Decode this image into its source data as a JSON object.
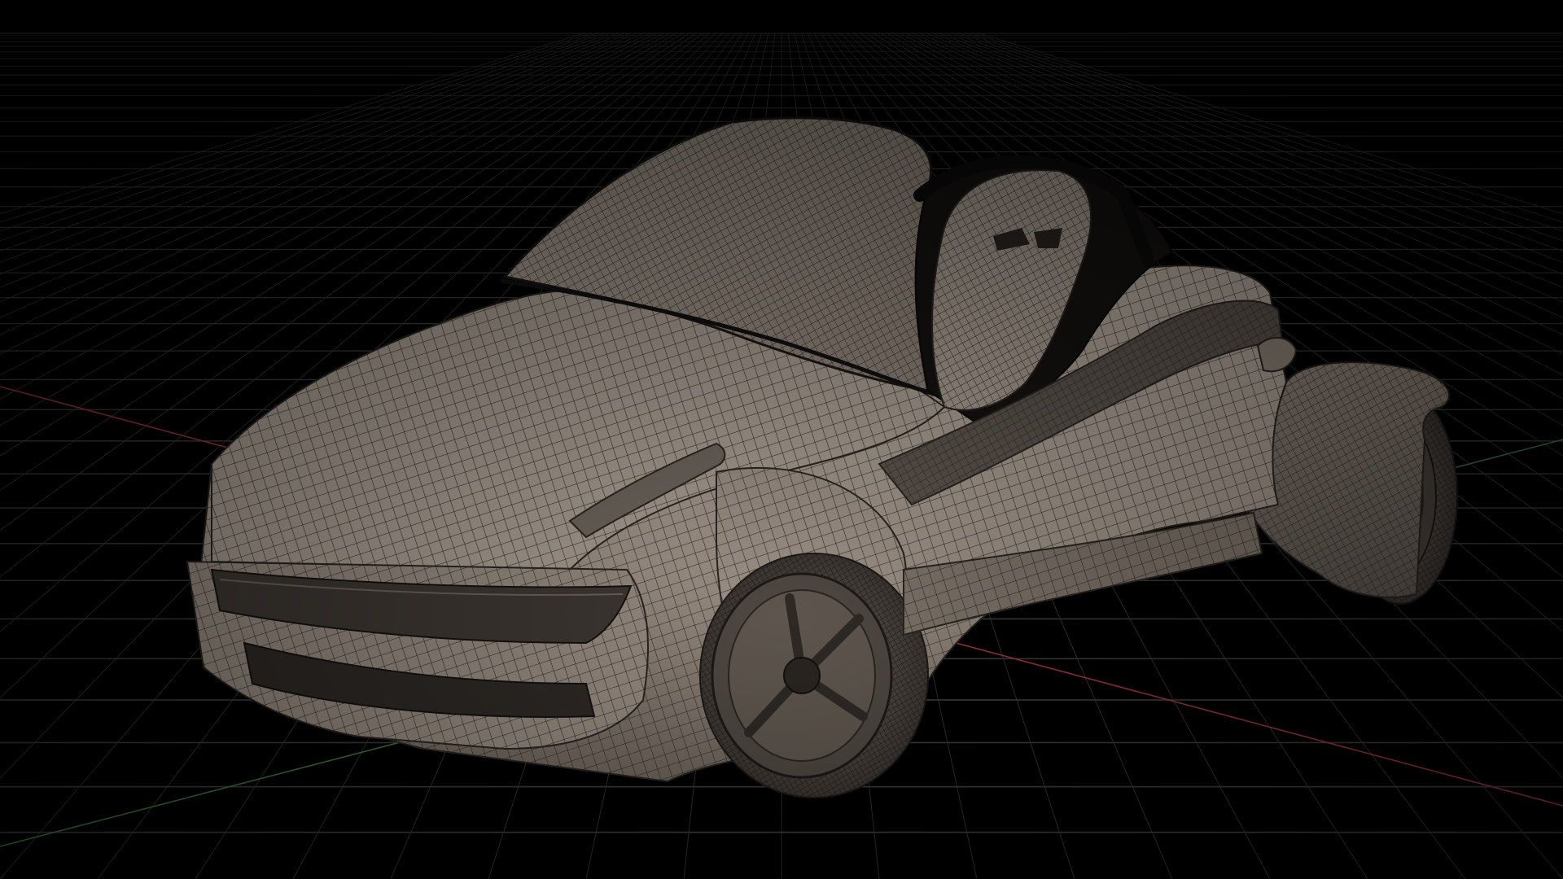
{
  "viewport": {
    "view": "perspective",
    "shading": "wireframe-on-shaded",
    "grid_visible": true,
    "axes_visible": true
  },
  "colors": {
    "background": "#000000",
    "grid_line": "#3a3a3a",
    "x_axis": "#a0343c",
    "z_axis": "#3f7a3c",
    "model_surface": "#8c8075",
    "model_surface_light": "#b3a89c",
    "model_surface_dark": "#4e4842",
    "model_wire": "#2a2521",
    "cockpit_dark": "#141210"
  },
  "model": {
    "subject": "concept car",
    "parts": [
      "body",
      "canopy",
      "seat",
      "roll-bar",
      "front-wheel",
      "rear-wheel",
      "headlight-strip",
      "side-stripe"
    ]
  }
}
